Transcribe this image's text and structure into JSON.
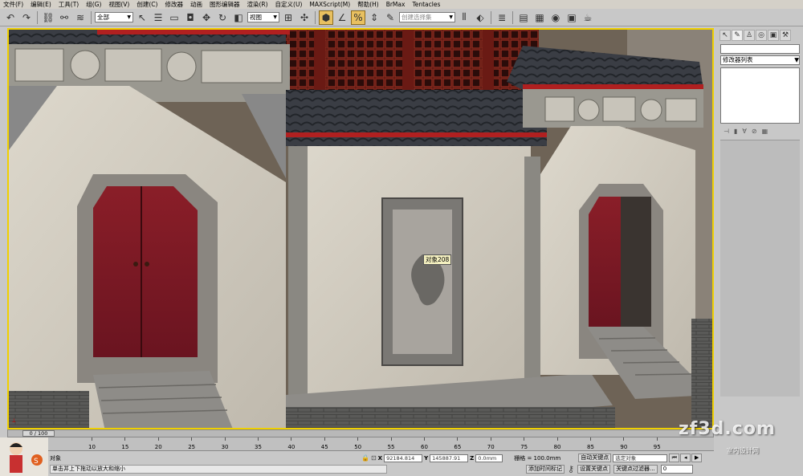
{
  "menu": [
    "文件(F)",
    "编辑(E)",
    "工具(T)",
    "组(G)",
    "视图(V)",
    "创建(C)",
    "修改器",
    "动画",
    "图形编辑器",
    "渲染(R)",
    "自定义(U)",
    "MAXScript(M)",
    "帮助(H)",
    "BrMax",
    "Tentacles"
  ],
  "toolbar": {
    "selection_filter": "全部",
    "ref_coord": "视图",
    "named_selection": "创建选择集"
  },
  "viewport": {
    "object_label": "对象208"
  },
  "command_panel": {
    "modifier_list": "修改器列表"
  },
  "timeline": {
    "slider_label": "0 / 100",
    "ticks": [
      "10",
      "15",
      "20",
      "25",
      "30",
      "35",
      "40",
      "45",
      "50",
      "55",
      "60",
      "65",
      "70",
      "75",
      "80",
      "85",
      "90",
      "95"
    ]
  },
  "status": {
    "selection_text": "对象",
    "prompt": "单击并上下拖动以放大和缩小",
    "x_label": "X",
    "x_value": "92184.814",
    "y_label": "Y",
    "y_value": "145887.91",
    "z_label": "Z",
    "z_value": "0.0mm",
    "grid": "栅格 = 100.0mm",
    "add_time_tag": "添加时间标记",
    "auto_key": "自动关键点",
    "set_key": "设置关键点",
    "selected_object": "选定对象",
    "key_filters": "关键点过滤器...",
    "frame": "0"
  },
  "watermark": {
    "site": "zf3d.com",
    "sub": "室内设计网"
  },
  "colors": {
    "viewport_border": "#f0d000",
    "active_button": "#e8c060",
    "door_red": "#8a1e28",
    "wall": "#d8d2c6"
  }
}
